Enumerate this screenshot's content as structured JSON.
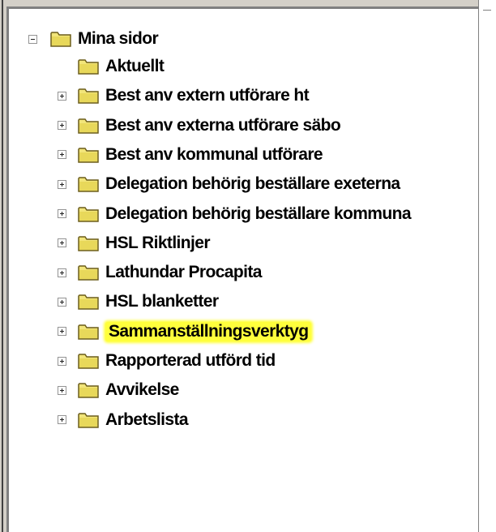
{
  "colors": {
    "highlight": "#ffff3c",
    "folder": "#f2e57a",
    "folder_edge": "#6b5d1a"
  },
  "tree": {
    "root": {
      "label": "Mina sidor",
      "icon": "folder-icon",
      "expanded": true
    },
    "children": [
      {
        "label": "Aktuellt",
        "has_children": false,
        "highlighted": false
      },
      {
        "label": "Best anv extern utförare ht",
        "has_children": true,
        "highlighted": false
      },
      {
        "label": "Best anv externa utförare säbo",
        "has_children": true,
        "highlighted": false
      },
      {
        "label": "Best anv kommunal utförare",
        "has_children": true,
        "highlighted": false
      },
      {
        "label": "Delegation behörig beställare exeterna",
        "has_children": true,
        "highlighted": false
      },
      {
        "label": "Delegation behörig beställare kommuna",
        "has_children": true,
        "highlighted": false
      },
      {
        "label": "HSL Riktlinjer",
        "has_children": true,
        "highlighted": false
      },
      {
        "label": "Lathundar Procapita",
        "has_children": true,
        "highlighted": false
      },
      {
        "label": "HSL blanketter",
        "has_children": true,
        "highlighted": false
      },
      {
        "label": "Sammanställningsverktyg",
        "has_children": true,
        "highlighted": true
      },
      {
        "label": "Rapporterad utförd tid",
        "has_children": true,
        "highlighted": false
      },
      {
        "label": "Avvikelse",
        "has_children": true,
        "highlighted": false
      },
      {
        "label": "Arbetslista",
        "has_children": true,
        "highlighted": false
      }
    ]
  }
}
